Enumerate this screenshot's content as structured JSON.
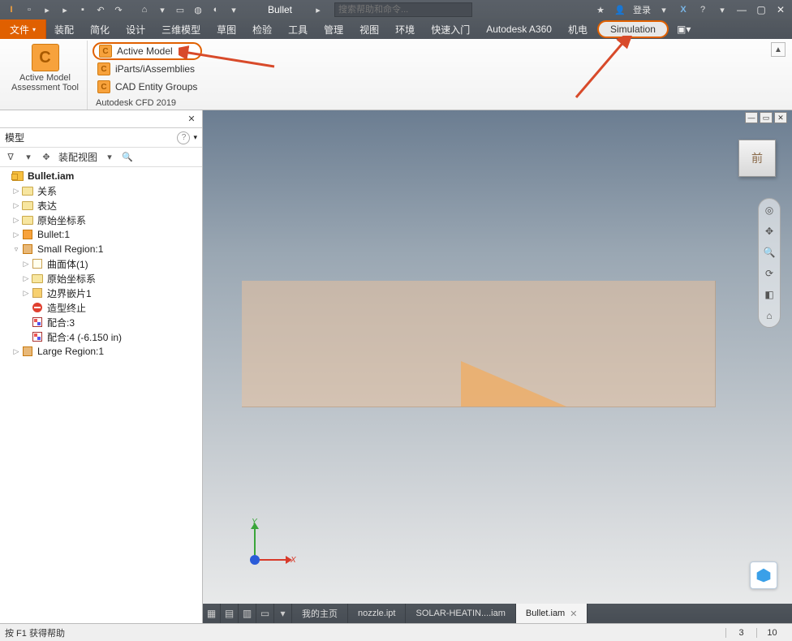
{
  "qat": {
    "doc_title": "Bullet",
    "search_placeholder": "搜索帮助和命令...",
    "login_label": "登录"
  },
  "menubar": {
    "file": "文件",
    "items": [
      "装配",
      "简化",
      "设计",
      "三维模型",
      "草图",
      "检验",
      "工具",
      "管理",
      "视图",
      "环境",
      "快速入门",
      "Autodesk A360",
      "机电"
    ],
    "simulation": "Simulation"
  },
  "ribbon": {
    "big_button_line1": "Active Model",
    "big_button_line2": "Assessment Tool",
    "options": {
      "active_model": "Active Model",
      "iparts": "iParts/iAssemblies",
      "cad_groups": "CAD Entity Groups"
    },
    "footer": "Autodesk CFD 2019"
  },
  "sidebar": {
    "panel_dropdown": "模型",
    "view_label": "装配视图",
    "root": "Bullet.iam",
    "nodes": {
      "relations": "关系",
      "reps": "表达",
      "origin": "原始坐标系",
      "bullet1": "Bullet:1",
      "small_region": "Small Region:1",
      "surf_body": "曲面体(1)",
      "origin2": "原始坐标系",
      "boundary": "边界嵌片1",
      "model_stop": "造型终止",
      "mate3": "配合:3",
      "mate4": "配合:4 (-6.150 in)",
      "large_region": "Large Region:1"
    }
  },
  "viewport": {
    "viewcube_face": "前",
    "triad": {
      "x": "X",
      "y": "Y"
    }
  },
  "doctabs": {
    "home": "我的主页",
    "tabs": [
      "nozzle.ipt",
      "SOLAR-HEATIN....iam",
      "Bullet.iam"
    ],
    "active_index": 2
  },
  "status": {
    "hint": "按 F1 获得帮助",
    "cell1": "3",
    "cell2": "10"
  }
}
